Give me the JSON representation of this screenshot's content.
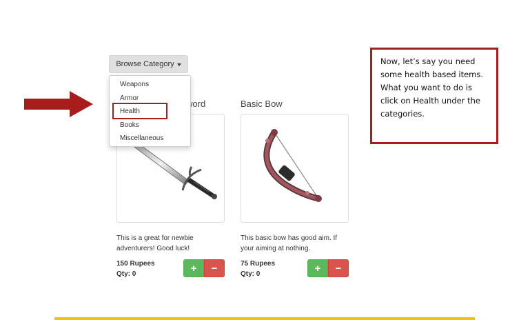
{
  "browse": {
    "label": "Browse Category"
  },
  "dropdown": {
    "items": [
      "Weapons",
      "Armor",
      "Health",
      "Books",
      "Miscellaneous"
    ]
  },
  "products": [
    {
      "title_fragment": "word",
      "description": [
        "This is a great for newbie",
        "adventurers! Good luck!"
      ],
      "price": "150 Rupees",
      "qty": "Qty: 0",
      "image_icon": "sword-icon"
    },
    {
      "title": "Basic Bow",
      "description": [
        "This basic bow has good aim. If",
        "your aiming at nothing."
      ],
      "price": "75 Rupees",
      "qty": "Qty: 0",
      "image_icon": "bow-icon"
    }
  ],
  "buttons": {
    "plus": "+",
    "minus": "−"
  },
  "callout": {
    "lines": [
      "Now, let’s say you need",
      "some health based items.",
      "What you want to do is",
      "click on Health under the",
      "categories."
    ]
  },
  "colors": {
    "annotation_red": "#a81c1c",
    "footer_yellow": "#f5c10f",
    "plus_green": "#5cb85c",
    "minus_red": "#d9534f"
  }
}
